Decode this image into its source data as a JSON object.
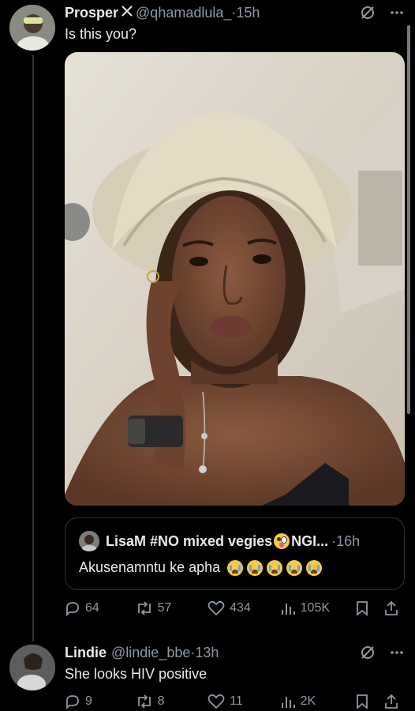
{
  "tweet1": {
    "name": "Prosper",
    "handle": "@qhamadlula_",
    "separator": "·",
    "time": "15h",
    "text": "Is this you?",
    "quote": {
      "name": "LisaM #NO mixed vegies",
      "name_suffix": "NGI...",
      "separator": "·",
      "time": "16h",
      "text": "Akusenamntu ke apha"
    },
    "stats": {
      "replies": "64",
      "reposts": "57",
      "likes": "434",
      "views": "105K"
    }
  },
  "tweet2": {
    "name": "Lindie",
    "handle": "@lindie_bbe",
    "separator": "·",
    "time": "13h",
    "text": "She looks HIV positive",
    "stats": {
      "replies": "9",
      "reposts": "8",
      "likes": "11",
      "views": "2K"
    }
  },
  "icons": [
    "x-verified-icon",
    "grok-icon",
    "more-icon",
    "reply-icon",
    "repost-icon",
    "like-icon",
    "views-icon",
    "bookmark-icon",
    "share-icon",
    "loudly-crying-emoji",
    "zany-face-emoji"
  ],
  "colors": {
    "background": "#000000",
    "text": "#e7e9ea",
    "secondary": "#8b98a5",
    "border": "#2f3336"
  }
}
